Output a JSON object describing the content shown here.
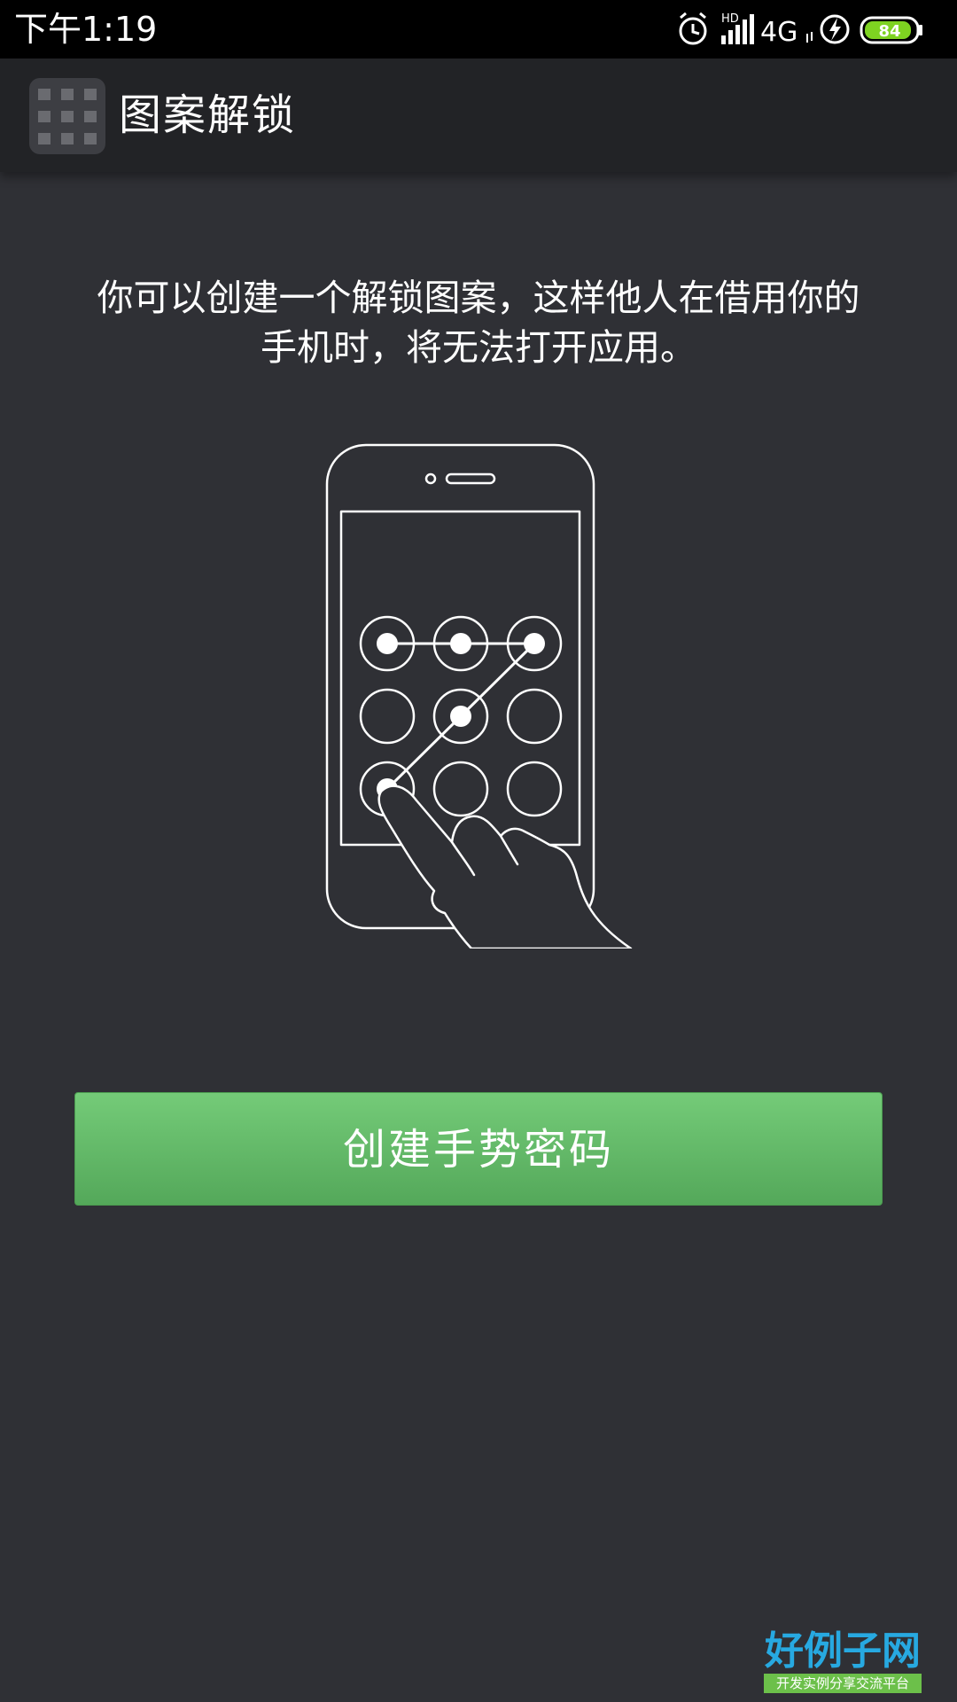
{
  "status_bar": {
    "time": "下午1:19",
    "signal_label": "HD",
    "network": "4G",
    "battery": "84",
    "battery_color": "#7ed321"
  },
  "app_bar": {
    "title": "图案解锁",
    "icon": "grid-icon"
  },
  "content": {
    "description_line1": "你可以创建一个解锁图案，这样他人在借用你的",
    "description_line2": "手机时，将无法打开应用。",
    "illustration_icon": "phone-pattern-lock-illustration"
  },
  "actions": {
    "create_label": "创建手势密码",
    "button_color": "#66bb6a"
  },
  "watermark": {
    "main": "好例子网",
    "sub": "开发实例分享交流平台"
  }
}
